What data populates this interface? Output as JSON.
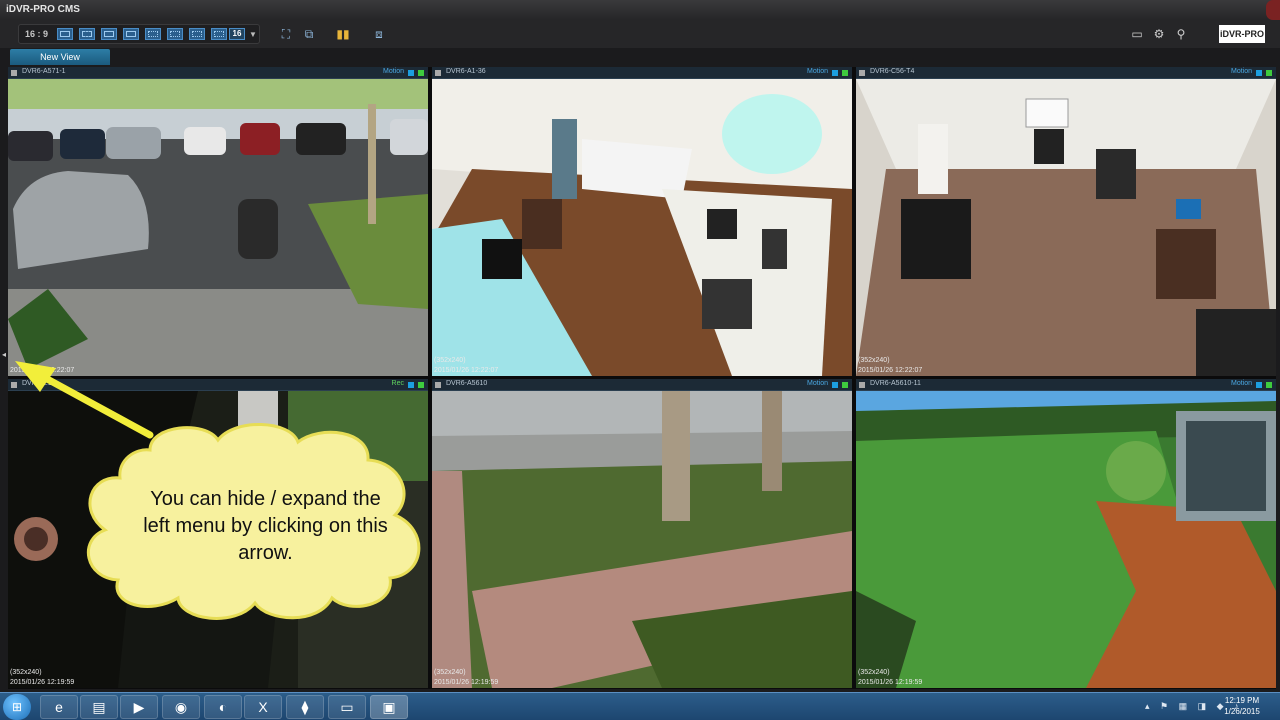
{
  "window": {
    "title": "iDVR-PRO CMS",
    "brand_logo": "iDVR-PRO"
  },
  "toolbar": {
    "aspect_ratio": "16 : 9",
    "layout_count_label": "16",
    "layout_buttons": [
      "layout-1x1",
      "layout-2x2",
      "layout-1x3",
      "layout-2x3",
      "layout-3x3",
      "layout-3x4",
      "layout-4x3",
      "layout-4x4"
    ],
    "icons": [
      "fullscreen-icon",
      "dual-monitor-icon",
      "audio-levels-icon",
      "sequence-icon"
    ],
    "right_icons": [
      "keyboard-icon",
      "gear-icon",
      "search-icon"
    ]
  },
  "tabs": [
    {
      "label": "New View"
    }
  ],
  "cameras": [
    {
      "name": "DVR6-A571-1",
      "mode": "Motion",
      "resolution": "",
      "timestamp": "2015/01/26 12:22:07"
    },
    {
      "name": "DVR6-A1-36",
      "mode": "Motion",
      "resolution": "(352x240)",
      "timestamp": "2015/01/26 12:22:07"
    },
    {
      "name": "DVR6-C56-T4",
      "mode": "Motion",
      "resolution": "(352x240)",
      "timestamp": "2015/01/26 12:22:07"
    },
    {
      "name": "DVR6-E1",
      "mode": "Rec",
      "resolution": "(352x240)",
      "timestamp": "2015/01/26 12:19:59"
    },
    {
      "name": "DVR6-A5610",
      "mode": "Motion",
      "resolution": "(352x240)",
      "timestamp": "2015/01/26 12:19:59"
    },
    {
      "name": "DVR6-A5610-11",
      "mode": "Motion",
      "resolution": "(352x240)",
      "timestamp": "2015/01/26 12:19:59"
    }
  ],
  "annotation": {
    "text": "You can hide / expand the left menu by clicking on this arrow.",
    "arrow_color": "#f2ee3a",
    "cloud_color": "#f7f19e"
  },
  "taskbar": {
    "apps": [
      "ie-icon",
      "folder-icon",
      "media-player-icon",
      "chrome-icon",
      "firefox-icon",
      "excel-icon",
      "network-icon",
      "window-icon",
      "cms-icon"
    ],
    "time": "12:19 PM",
    "date": "1/26/2015"
  }
}
